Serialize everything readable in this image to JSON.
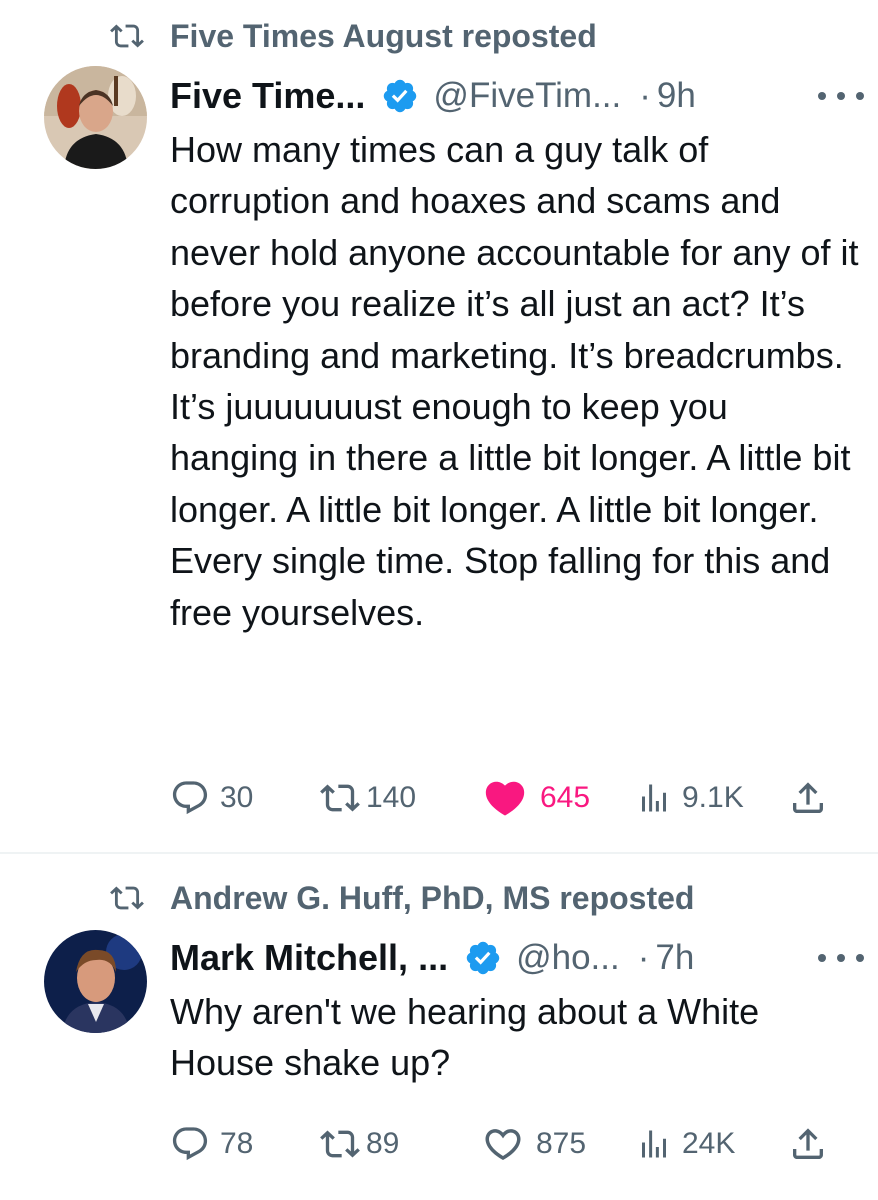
{
  "posts": [
    {
      "repost_by": "Five Times August reposted",
      "display_name": "Five Time...",
      "handle": "@FiveTim...",
      "time": "9h",
      "text": "How many times can a guy talk of corruption and hoaxes and scams and never hold anyone accountable for any of it before you realize it’s all just an act? It’s branding and marketing. It’s breadcrumbs. It’s juuuuuuust enough to keep you hanging in there a little bit longer. A little bit longer. A little bit longer. A little bit longer. Every single time. Stop falling for this and free yourselves.",
      "replies": "30",
      "reposts": "140",
      "likes": "645",
      "views": "9.1K",
      "liked": true
    },
    {
      "repost_by": "Andrew G. Huff, PhD, MS reposted",
      "display_name": "Mark Mitchell, ...",
      "handle": "@ho...",
      "time": "7h",
      "text": "Why aren't we hearing about a White House shake up?",
      "replies": "78",
      "reposts": "89",
      "likes": "875",
      "views": "24K",
      "liked": false
    }
  ],
  "colors": {
    "text": "#0f1419",
    "muted": "#536471",
    "like": "#f91880",
    "verified": "#1d9bf0"
  }
}
